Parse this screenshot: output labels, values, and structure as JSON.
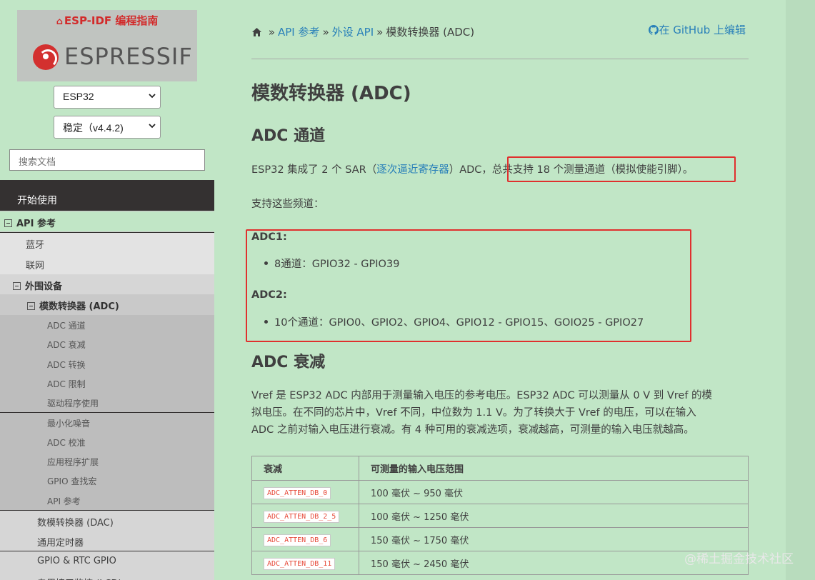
{
  "sidebar": {
    "logo_title": "ESP-IDF 编程指南",
    "logo_word": "ESPRESSIF",
    "chip_select": "ESP32",
    "version_select": "稳定（v4.4.2)",
    "search_placeholder": "搜索文档",
    "start": "开始使用",
    "api": "API 参考",
    "level2": [
      "蓝牙",
      "联网"
    ],
    "peripherals": "外围设备",
    "adc": "模数转换器 (ADC)",
    "adc_children": [
      "ADC 通道",
      "ADC 衰减",
      "ADC 转换",
      "ADC 限制",
      "驱动程序使用",
      "最小化噪音",
      "ADC 校准",
      "应用程序扩展",
      "GPIO 查找宏",
      "API 参考"
    ],
    "level3_after": [
      "数模转换器 (DAC)",
      "通用定时器",
      "GPIO & RTC GPIO",
      "专用接口监控 (LCD)"
    ]
  },
  "breadcrumb": {
    "sep": "»",
    "api": "API 参考",
    "periph": "外设 API",
    "current": "模数转换器 (ADC)"
  },
  "github_link": "在 GitHub 上编辑",
  "content": {
    "title": "模数转换器 (ADC)",
    "section1": "ADC 通道",
    "p1_pre": "ESP32 集成了 2 个 SAR（",
    "p1_link": "逐次逼近寄存器",
    "p1_mid": "）ADC，",
    "p1_highlight": "总共支持 18 个测量通道（模拟使能引脚）。",
    "p2": "支持这些频道：",
    "adc1_label": "ADC1:",
    "adc1_item": "8通道：GPIO32 - GPIO39",
    "adc2_label": "ADC2:",
    "adc2_item": "10个通道：GPIO0、GPIO2、GPIO4、GPIO12 - GPIO15、GOIO25 - GPIO27",
    "section2": "ADC 衰减",
    "p3_line1": "Vref 是 ESP32 ADC 内部用于测量输入电压的参考电压。ESP32 ADC 可以测量从 0 V 到 Vref 的模",
    "p3_line2": "拟电压。在不同的芯片中，Vref 不同，中位数为 1.1 V。为了转换大于 Vref 的电压，可以在输入",
    "p3_line3": "ADC 之前对输入电压进行衰减。有 4 种可用的衰减选项，衰减越高，可测量的输入电压就越高。",
    "table": {
      "headers": [
        "衰减",
        "可测量的输入电压范围"
      ],
      "rows": [
        [
          "ADC_ATTEN_DB_0",
          "100 毫伏 ~ 950 毫伏"
        ],
        [
          "ADC_ATTEN_DB_2_5",
          "100 毫伏 ~ 1250 毫伏"
        ],
        [
          "ADC_ATTEN_DB_6",
          "150 毫伏 ~ 1750 毫伏"
        ],
        [
          "ADC_ATTEN_DB_11",
          "150 毫伏 ~ 2450 毫伏"
        ]
      ]
    }
  },
  "watermark": "@稀土掘金技术社区",
  "colors": {
    "background": "#c1e6c6",
    "link": "#2980b9",
    "highlight_box": "#e0302e",
    "sidebar_dark": "#343131"
  }
}
